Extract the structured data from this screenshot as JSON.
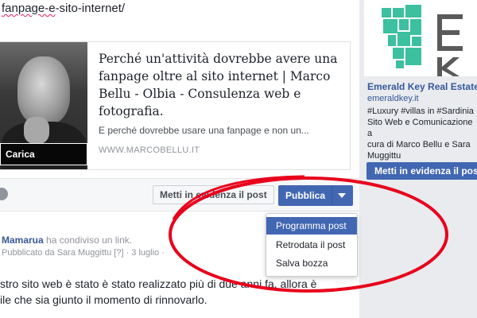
{
  "composer": {
    "url_text": "fanpage-e-sito-internet/",
    "url_squiggle_text": "fanpage-e"
  },
  "link_preview": {
    "title": "Perché un'attività dovrebbe avere una fanpage oltre al sito internet | Marco Bellu - Olbia - Consulenza web e fotografia.",
    "description": "E perché dovrebbe usare una fanpage e non un...",
    "domain": "WWW.MARCOBELLU.IT",
    "upload_label": "Carica immagine"
  },
  "toolbar": {
    "highlight_label": "Metti in evidenza il post",
    "publish_label": "Pubblica"
  },
  "publish_menu": {
    "items": [
      {
        "label": "Programma post",
        "active": true
      },
      {
        "label": "Retrodata il post",
        "active": false
      },
      {
        "label": "Salva bozza",
        "active": false
      }
    ]
  },
  "post": {
    "author": "Mamarua",
    "action": "ha condiviso un link.",
    "published_by": "Pubblicato da Sara Muggittu",
    "help": "[?]",
    "date": "· 3 luglio ·",
    "text_line1": "stro sito web è stato è stato realizzato più di due anni fa, allora è",
    "text_line2": "ile che sia giunto il momento di rinnovarlo."
  },
  "sidebar": {
    "page_name": "Emerald Key Real Estate, I",
    "link": "emeraldkey.it",
    "desc_line1": "#Luxury #villas in #Sardinia",
    "desc_line2": "Sito Web e Comunicazione a",
    "desc_line3": "cura di Marco Bellu e Sara",
    "desc_line4": "Muggittu",
    "highlight_btn": "Metti in evidenza il pos"
  },
  "colors": {
    "fb_blue": "#4267b2",
    "link_blue": "#365899",
    "annotation_red": "#e8001c",
    "logo_teal": "#3cc0a0"
  }
}
